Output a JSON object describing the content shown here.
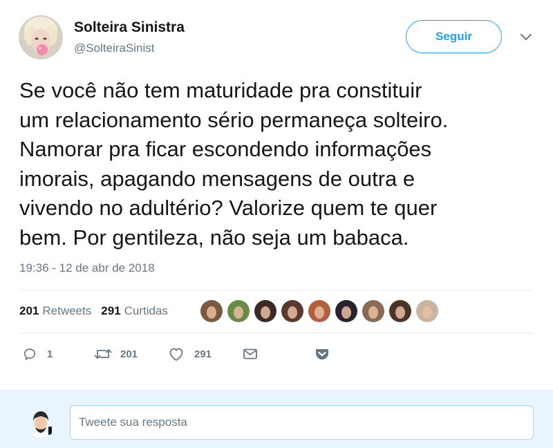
{
  "user": {
    "display_name": "Solteira Sinistra",
    "handle": "@SolteiraSinist"
  },
  "follow_button": {
    "label": "Seguir"
  },
  "tweet": {
    "lines": [
      "Se você não tem maturidade pra constituir",
      "um relacionamento sério permaneça solteiro.",
      "Namorar pra ficar escondendo informações",
      "imorais, apagando mensagens de outra e",
      "vivendo no adultério? Valorize quem te quer",
      "bem. Por gentileza, não seja um babaca."
    ],
    "timestamp": "19:36 - 12 de abr de 2018"
  },
  "stats": {
    "retweets_count": "201",
    "retweets_label": "Retweets",
    "likes_count": "291",
    "likes_label": "Curtidas"
  },
  "likers": [
    {
      "color": "#7a5a3c"
    },
    {
      "color": "#6b8a4a"
    },
    {
      "color": "#3c2a24"
    },
    {
      "color": "#5a3a30"
    },
    {
      "color": "#b06040"
    },
    {
      "color": "#2a2230"
    },
    {
      "color": "#8a6a52"
    },
    {
      "color": "#4a3428"
    },
    {
      "color": "#c8b4a0"
    }
  ],
  "actions": {
    "reply_count": "1",
    "retweet_count": "201",
    "like_count": "291"
  },
  "reply_box": {
    "placeholder": "Tweete sua resposta"
  },
  "colors": {
    "accent": "#1da1f2",
    "secondary_text": "#657786",
    "reply_bar_bg": "#e8f5fd"
  }
}
